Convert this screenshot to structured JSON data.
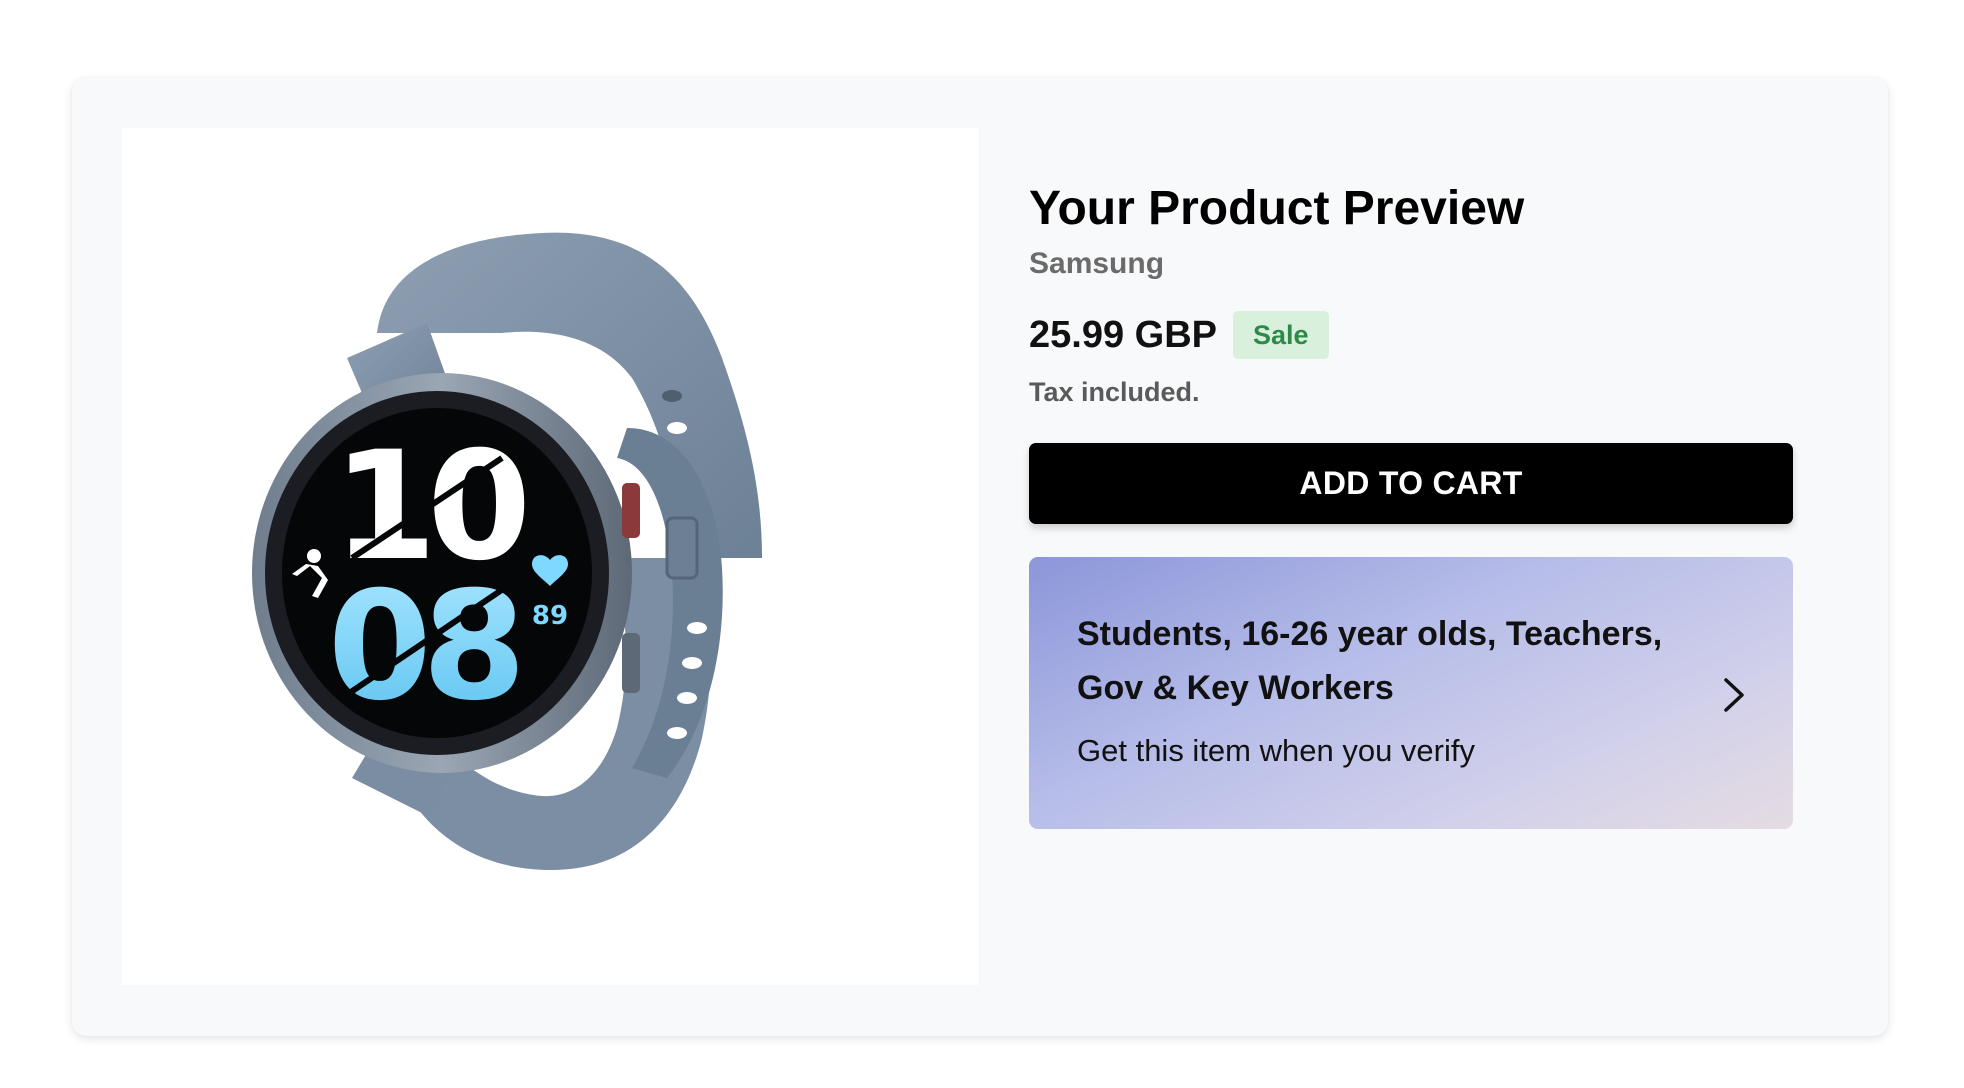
{
  "product": {
    "title": "Your Product Preview",
    "vendor": "Samsung",
    "price": "25.99 GBP",
    "badge": "Sale",
    "tax_note": "Tax included.",
    "image_icon": "smartwatch-product-image",
    "watch_face": {
      "hour": "10",
      "minute": "08",
      "heart_rate": "89"
    }
  },
  "cart": {
    "add_label": "ADD TO CART"
  },
  "verify": {
    "title": "Students, 16-26 year olds, Teachers, Gov & Key Workers",
    "subtitle": "Get this item when you verify",
    "icon": "chevron-right-icon"
  },
  "colors": {
    "button": "#000000",
    "badge_bg": "#d9f0dd",
    "badge_text": "#2f8a4a",
    "verify_gradient_start": "#8c96d9",
    "verify_gradient_end": "#e5dce2"
  }
}
